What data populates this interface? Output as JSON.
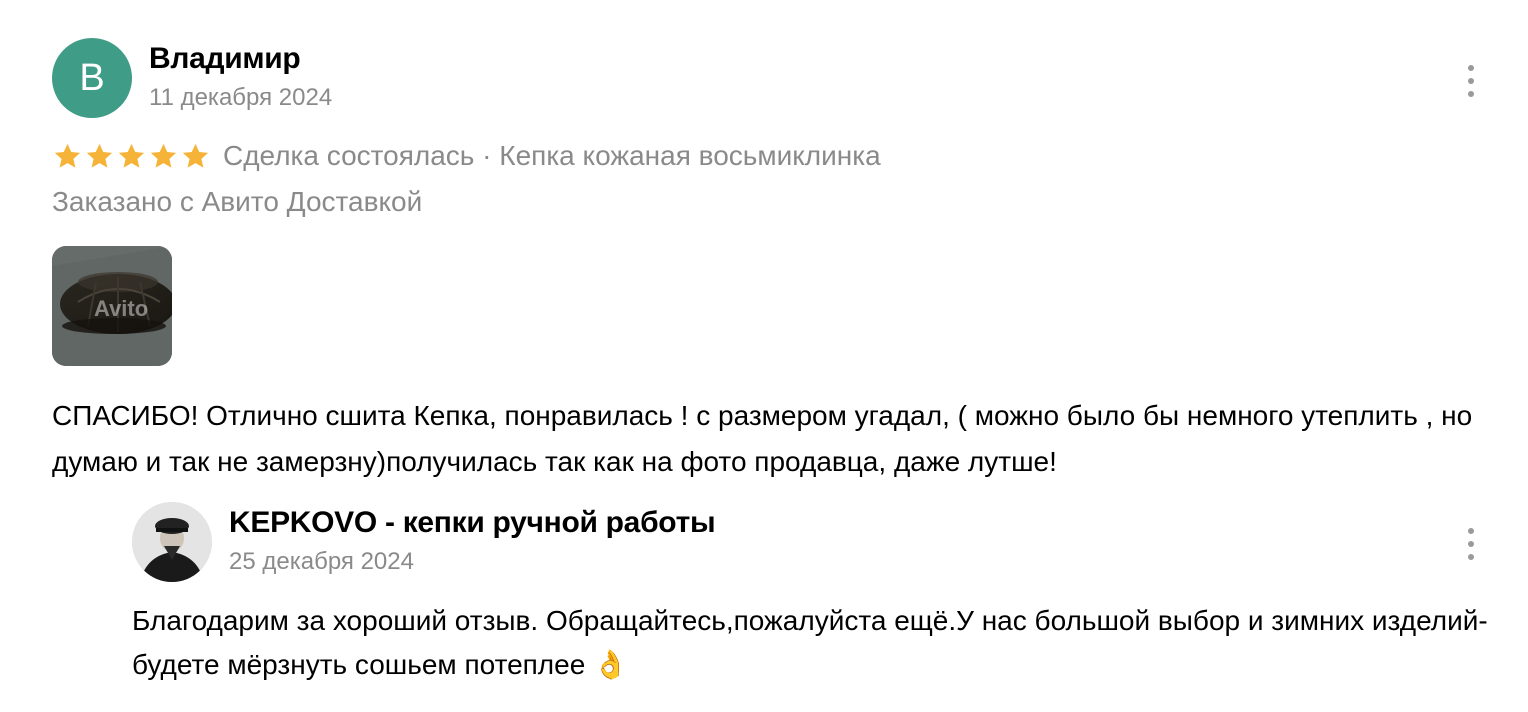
{
  "review": {
    "author": {
      "initial": "В",
      "name": "Владимир",
      "avatar_color": "#3f9c86"
    },
    "date": "11 декабря 2024",
    "rating": 5,
    "star_color": "#f5b437",
    "deal_status": "Сделка состоялась · Кепка кожаная восьмиклинка",
    "delivery": "Заказано с Авито Доставкой",
    "photo_watermark": "Avito",
    "text": "СПАСИБО! Отлично сшита Кепка, понравилась ! с размером угадал,  ( можно было бы немного утеплить , но думаю и так не замерзну)получилась так как на фото продавца, даже лутше!",
    "menu_icon": "kebab-menu-icon"
  },
  "reply": {
    "author": {
      "name": "KEPKOVO - кепки ручной работы"
    },
    "date": "25 декабря 2024",
    "text": "Благодарим за хороший отзыв. Обращайтесь,пожалуйста ещё.У нас большой выбор и зимних изделий-будете мёрзнуть сошьем потеплее 👌",
    "menu_icon": "kebab-menu-icon"
  }
}
